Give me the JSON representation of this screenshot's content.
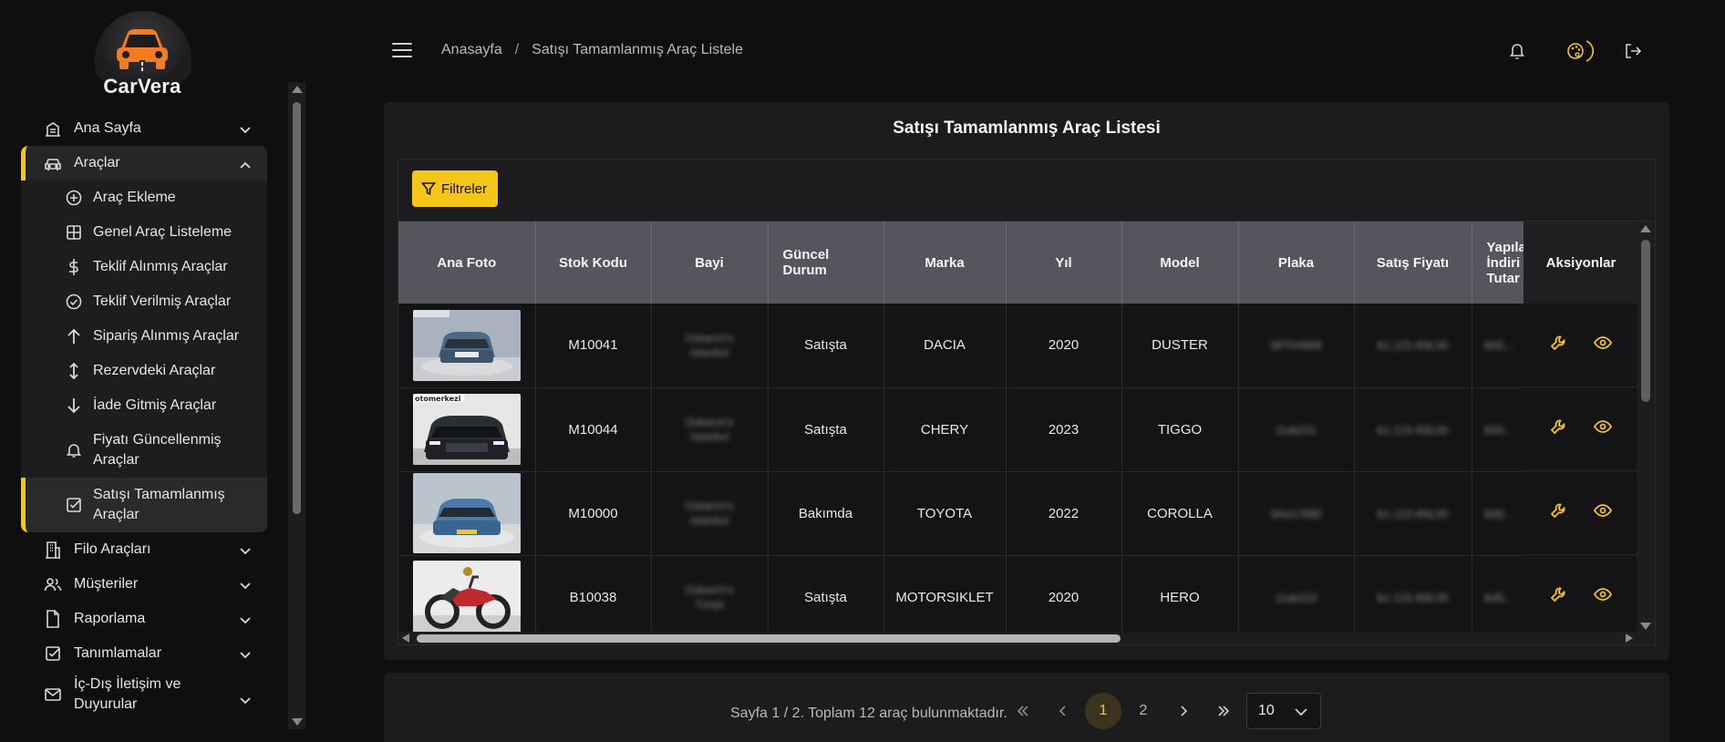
{
  "brand": {
    "name": "CarVera"
  },
  "breadcrumb": {
    "home": "Anasayfa",
    "separator": "/",
    "current": "Satışı Tamamlanmış Araç Listele"
  },
  "header_icons": [
    "bell-icon",
    "palette-icon",
    "logout-icon"
  ],
  "sidebar": {
    "items": [
      {
        "label": "Ana Sayfa",
        "icon": "building-icon"
      },
      {
        "label": "Araçlar",
        "icon": "car-icon",
        "expanded": true,
        "children": [
          {
            "label": "Araç Ekleme",
            "icon": "plus-circle-icon"
          },
          {
            "label": "Genel Araç Listeleme",
            "icon": "grid-icon"
          },
          {
            "label": "Teklif Alınmış Araçlar",
            "icon": "dollar-icon"
          },
          {
            "label": "Teklif Verilmiş Araçlar",
            "icon": "check-circle-icon"
          },
          {
            "label": "Sipariş Alınmış Araçlar",
            "icon": "arrow-up-icon"
          },
          {
            "label": "Rezervdeki Araçlar",
            "icon": "arrows-vertical-icon"
          },
          {
            "label": "İade Gitmiş Araçlar",
            "icon": "arrow-down-icon"
          },
          {
            "label_line1": "Fiyatı Güncellenmiş",
            "label_line2": "Araçlar",
            "icon": "bell-icon"
          },
          {
            "label_line1": "Satışı Tamamlanmış",
            "label_line2": "Araçlar",
            "icon": "checkbox-icon",
            "active": true
          }
        ]
      },
      {
        "label": "Filo Araçları",
        "icon": "building-tall-icon"
      },
      {
        "label": "Müşteriler",
        "icon": "users-icon"
      },
      {
        "label": "Raporlama",
        "icon": "file-icon"
      },
      {
        "label": "Tanımlamalar",
        "icon": "checkbox-icon"
      },
      {
        "label_line1": "İç-Dış İletişim ve",
        "label_line2": "Duyurular",
        "icon": "mail-icon"
      }
    ]
  },
  "page": {
    "title": "Satışı Tamamlanmış Araç Listesi",
    "filter_button": "Filtreler"
  },
  "table": {
    "columns": [
      "Ana Foto",
      "Stok Kodu",
      "Bayi",
      "Güncel Durum",
      "Marka",
      "Yıl",
      "Model",
      "Plaka",
      "Satış Fiyatı",
      "Yapılan İndirim Tutarı",
      "Aksiyonlar"
    ],
    "col_guncel_line1": "Güncel",
    "col_guncel_line2": "Durum",
    "col_yapilan_line1": "Yapıla",
    "col_yapilan_line2": "İndiri",
    "col_yapilan_line3": "Tutar",
    "rows": [
      {
        "stok": "M10041",
        "bayi1": "Oskarch's",
        "bayi2": "Istanbul",
        "durum": "Satışta",
        "marka": "DACIA",
        "yil": "2020",
        "model": "DUSTER",
        "plaka": "06TH4999",
        "fiyat": "₺1.123.456,00",
        "indirim": "₺55..."
      },
      {
        "stok": "M10044",
        "bayi1": "Oskarch's",
        "bayi2": "Istanbul",
        "durum": "Satışta",
        "marka": "CHERY",
        "yil": "2023",
        "model": "TIGGO",
        "plaka": "11ab231",
        "fiyat": "₺1.123.456,00",
        "indirim": "₺55..."
      },
      {
        "stok": "M10000",
        "bayi1": "Oskarch's",
        "bayi2": "Istanbul",
        "durum": "Bakımda",
        "marka": "TOYOTA",
        "yil": "2022",
        "model": "COROLLA",
        "plaka": "06sm7890",
        "fiyat": "₺1.123.456,00",
        "indirim": "₺65..."
      },
      {
        "stok": "B10038",
        "bayi1": "Oskarch's",
        "bayi2": "Tunçli",
        "durum": "Satışta",
        "marka": "MOTORSIKLET",
        "yil": "2020",
        "model": "HERO",
        "plaka": "11ab222",
        "fiyat": "₺1.123.456,00",
        "indirim": "₺45..."
      }
    ]
  },
  "pagination": {
    "summary": "Sayfa 1 / 2. Toplam 12 araç bulunmaktadır.",
    "pages": [
      "1",
      "2"
    ],
    "current_page": "1",
    "page_size": "10"
  },
  "colors": {
    "accent": "#f5c518",
    "background": "#0f0f10",
    "card": "#1c1c1f",
    "header": "#55555d"
  }
}
